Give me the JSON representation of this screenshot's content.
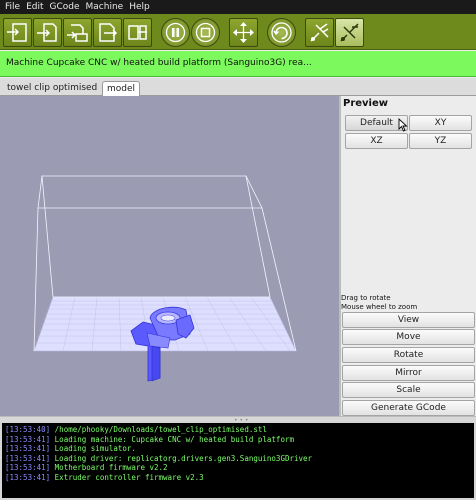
{
  "menu": [
    "File",
    "Edit",
    "GCode",
    "Machine",
    "Help"
  ],
  "toolbar": {
    "buttons": [
      "build-to-machine-icon",
      "build-file-icon",
      "upload-file-icon",
      "print-sd-icon",
      "build-sd-icon",
      "pause-icon",
      "stop-icon",
      "control-panel-icon",
      "reset-icon",
      "connect-icon",
      "disconnect-icon"
    ]
  },
  "status": {
    "text": "Machine Cupcake CNC w/ heated build platform (Sanguino3G) rea..."
  },
  "tabs": [
    {
      "label": "towel clip optimised",
      "active": false
    },
    {
      "label": "model",
      "active": true
    }
  ],
  "panel": {
    "title": "Preview",
    "view_buttons": [
      "Default",
      "XY",
      "XZ",
      "YZ"
    ],
    "hint_line1": "Drag to rotate",
    "hint_line2": "Mouse wheel to zoom",
    "actions": [
      "View",
      "Move",
      "Rotate",
      "Mirror",
      "Scale",
      "Generate GCode"
    ]
  },
  "console": [
    {
      "time": "[13:53:40]",
      "message": "/home/phooky/Downloads/towel_clip_optimised.stl"
    },
    {
      "time": "[13:53:41]",
      "message": "Loading machine: Cupcake CNC w/ heated build platform"
    },
    {
      "time": "[13:53:41]",
      "message": "Loading simulator."
    },
    {
      "time": "[13:53:41]",
      "message": "Loading driver: replicatorg.drivers.gen3.Sanguino3GDriver"
    },
    {
      "time": "[13:53:41]",
      "message": "Motherboard firmware v2.2"
    },
    {
      "time": "[13:53:41]",
      "message": "Extruder controller firmware v2.3"
    }
  ],
  "colors": {
    "toolbar": "#6f8a1c",
    "status_bar": "#7cfa5d",
    "viewport_bg": "#9b9bb3",
    "build_platform": "#d8d8ff",
    "model": "#6a6aff",
    "console_time": "#8a8aff",
    "console_text": "#7cff6a"
  }
}
